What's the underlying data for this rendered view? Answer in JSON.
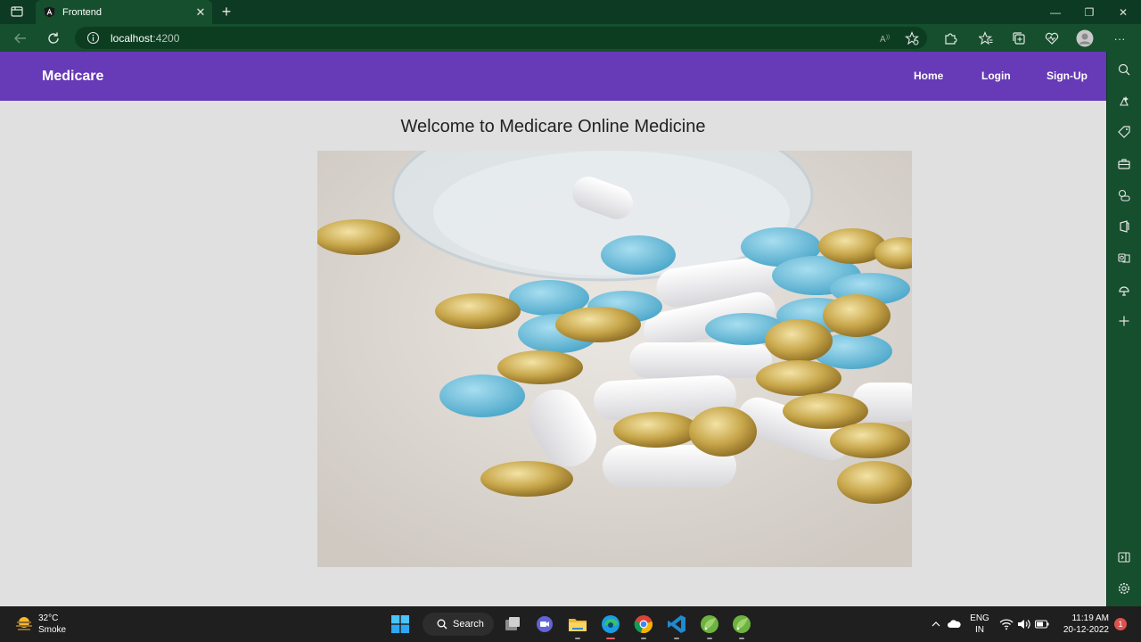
{
  "browser": {
    "tab_title": "Frontend",
    "new_tab_symbol": "+",
    "url_host": "localhost",
    "url_port": ":4200",
    "window_controls": {
      "minimize": "—",
      "maximize": "❐",
      "close": "✕"
    },
    "tab_close": "✕",
    "more_menu": "···"
  },
  "navbar": {
    "brand": "Medicare",
    "links": [
      "Home",
      "Login",
      "Sign-Up"
    ],
    "color": "#673ab7"
  },
  "main": {
    "heading": "Welcome to Medicare Online Medicine",
    "hero_image": "pills-image"
  },
  "sidebar": {
    "icons": [
      "search-icon",
      "copilot-icon",
      "shopping-tag-icon",
      "tools-icon",
      "games-icon",
      "office-icon",
      "outlook-icon",
      "drop-icon",
      "add-icon",
      "split-screen-icon",
      "settings-icon"
    ]
  },
  "taskbar": {
    "weather": {
      "temp": "32°C",
      "desc": "Smoke"
    },
    "search_label": "Search",
    "lang_top": "ENG",
    "lang_bottom": "IN",
    "time": "11:19 AM",
    "date": "20-12-2022",
    "notification_count": "1"
  }
}
